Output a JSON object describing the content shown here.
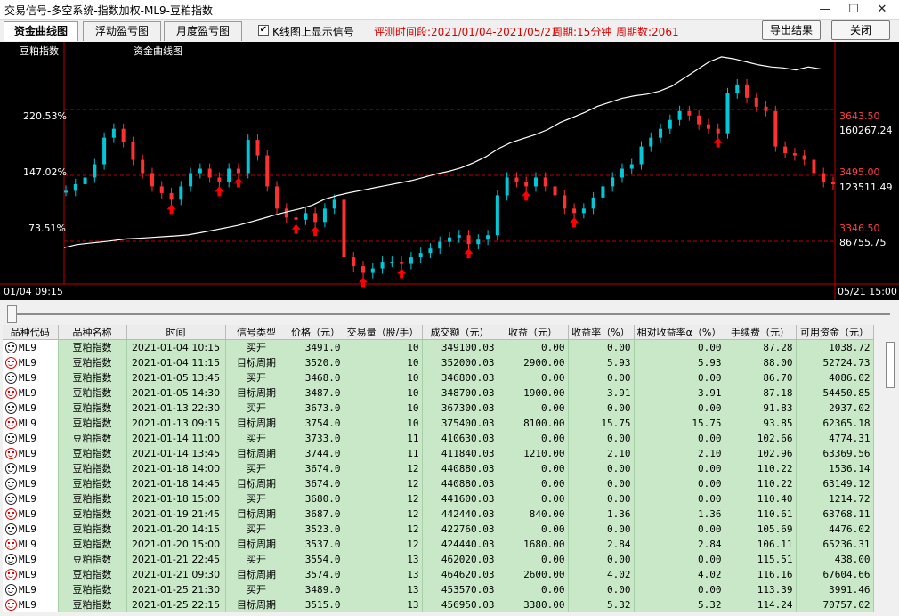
{
  "window": {
    "title": "交易信号-多空系统-指数加权-ML9-豆粕指数",
    "minimize": "—",
    "maximize": "☐",
    "close": "✕"
  },
  "toolbar": {
    "tabs": [
      {
        "label": "资金曲线图",
        "active": true
      },
      {
        "label": "浮动盈亏图",
        "active": false
      },
      {
        "label": "月度盈亏图",
        "active": false
      }
    ],
    "checkbox_checked": "✔",
    "checkbox_label": "K线图上显示信号",
    "period_range": "评测时间段:2021/01/04-2021/05/21",
    "period_type": "周期:15分钟",
    "period_count": "周期数:2061",
    "export_label": "导出结果",
    "close_label": "关闭"
  },
  "chart": {
    "label_left": "豆粕指数",
    "label_curve": "资金曲线图",
    "left_axis": [
      "220.53%",
      "147.02%",
      "73.51%"
    ],
    "price_levels": [
      "3643.50",
      "3495.00",
      "3346.50"
    ],
    "fund_levels": [
      "160267.24",
      "123511.49",
      "86755.75"
    ],
    "time_start": "01/04 09:15",
    "time_end": "05/21 15:00",
    "colors": {
      "candle_up": "#00c8d8",
      "candle_down": "#ff3030",
      "fund_line": "#ffffff",
      "grid": "#c00000",
      "signal": "#ff0000"
    }
  },
  "chart_data": {
    "type": "line",
    "series": [
      {
        "values": [
          3460,
          3475,
          3490,
          3520,
          3580,
          3600,
          3570,
          3530,
          3500,
          3470,
          3455,
          3440,
          3470,
          3500,
          3510,
          3490,
          3480,
          3510,
          3500,
          3575,
          3540,
          3470,
          3420,
          3400,
          3395,
          3410,
          3390,
          3420,
          3440,
          3310,
          3290,
          3275,
          3285,
          3300,
          3300,
          3295,
          3310,
          3320,
          3330,
          3345,
          3355,
          3360,
          3340,
          3350,
          3360,
          3450,
          3490,
          3480,
          3470,
          3490,
          3470,
          3450,
          3420,
          3410,
          3420,
          3445,
          3470,
          3490,
          3510,
          3520,
          3560,
          3580,
          3600,
          3620,
          3640,
          3630,
          3610,
          3600,
          3590,
          3680,
          3700,
          3670,
          3650,
          3640,
          3560,
          3545,
          3540,
          3530,
          3500,
          3480,
          3475
        ]
      },
      {
        "values": [
          84000,
          85500,
          86200,
          86800,
          87500,
          88300,
          88600,
          89000,
          89400,
          89800,
          90300,
          91400,
          92600,
          93800,
          95000,
          96700,
          98400,
          100200,
          101800,
          103200,
          105000,
          108000,
          109800,
          111200,
          112400,
          113600,
          114800,
          116000,
          117200,
          118800,
          120500,
          121800,
          123500,
          126000,
          129000,
          133000,
          136000,
          138000,
          140000,
          142500,
          146000,
          148500,
          151000,
          154000,
          156000,
          158000,
          159200,
          160000,
          161500,
          164000,
          168000,
          172000,
          176000,
          178500,
          177500,
          176000,
          174500,
          173500,
          173000,
          172000,
          173500,
          172500
        ]
      }
    ],
    "ylim": [
      3250,
      3760
    ],
    "y2lim": [
      66000,
      178000
    ]
  },
  "table": {
    "columns": [
      "品种代码",
      "品种名称",
      "时间",
      "信号类型",
      "价格（元）",
      "交易量（股/手）",
      "成交额（元）",
      "收益（元）",
      "收益率（%）",
      "相对收益率α（%）",
      "手续费（元）",
      "可用资金（元）"
    ],
    "rows": [
      {
        "code": "ML9",
        "name": "豆粕指数",
        "time": "2021-01-04 10:15",
        "type": "买开",
        "price": "3491.0",
        "vol": "10",
        "amount": "349100.03",
        "profit": "0.00",
        "rate": "0.00",
        "alpha": "0.00",
        "fee": "87.28",
        "cash": "1038.72",
        "face": "dark"
      },
      {
        "code": "ML9",
        "name": "豆粕指数",
        "time": "2021-01-04 11:15",
        "type": "目标周期",
        "price": "3520.0",
        "vol": "10",
        "amount": "352000.03",
        "profit": "2900.00",
        "rate": "5.93",
        "alpha": "5.93",
        "fee": "88.00",
        "cash": "52724.73",
        "face": "red"
      },
      {
        "code": "ML9",
        "name": "豆粕指数",
        "time": "2021-01-05 13:45",
        "type": "买开",
        "price": "3468.0",
        "vol": "10",
        "amount": "346800.03",
        "profit": "0.00",
        "rate": "0.00",
        "alpha": "0.00",
        "fee": "86.70",
        "cash": "4086.02",
        "face": "dark"
      },
      {
        "code": "ML9",
        "name": "豆粕指数",
        "time": "2021-01-05 14:30",
        "type": "目标周期",
        "price": "3487.0",
        "vol": "10",
        "amount": "348700.03",
        "profit": "1900.00",
        "rate": "3.91",
        "alpha": "3.91",
        "fee": "87.18",
        "cash": "54450.85",
        "face": "red"
      },
      {
        "code": "ML9",
        "name": "豆粕指数",
        "time": "2021-01-13 22:30",
        "type": "买开",
        "price": "3673.0",
        "vol": "10",
        "amount": "367300.03",
        "profit": "0.00",
        "rate": "0.00",
        "alpha": "0.00",
        "fee": "91.83",
        "cash": "2937.02",
        "face": "dark"
      },
      {
        "code": "ML9",
        "name": "豆粕指数",
        "time": "2021-01-13 09:15",
        "type": "目标周期",
        "price": "3754.0",
        "vol": "10",
        "amount": "375400.03",
        "profit": "8100.00",
        "rate": "15.75",
        "alpha": "15.75",
        "fee": "93.85",
        "cash": "62365.18",
        "face": "red"
      },
      {
        "code": "ML9",
        "name": "豆粕指数",
        "time": "2021-01-14 11:00",
        "type": "买开",
        "price": "3733.0",
        "vol": "11",
        "amount": "410630.03",
        "profit": "0.00",
        "rate": "0.00",
        "alpha": "0.00",
        "fee": "102.66",
        "cash": "4774.31",
        "face": "dark"
      },
      {
        "code": "ML9",
        "name": "豆粕指数",
        "time": "2021-01-14 13:45",
        "type": "目标周期",
        "price": "3744.0",
        "vol": "11",
        "amount": "411840.03",
        "profit": "1210.00",
        "rate": "2.10",
        "alpha": "2.10",
        "fee": "102.96",
        "cash": "63369.56",
        "face": "red"
      },
      {
        "code": "ML9",
        "name": "豆粕指数",
        "time": "2021-01-18 14:00",
        "type": "买开",
        "price": "3674.0",
        "vol": "12",
        "amount": "440880.03",
        "profit": "0.00",
        "rate": "0.00",
        "alpha": "0.00",
        "fee": "110.22",
        "cash": "1536.14",
        "face": "dark"
      },
      {
        "code": "ML9",
        "name": "豆粕指数",
        "time": "2021-01-18 14:45",
        "type": "目标周期",
        "price": "3674.0",
        "vol": "12",
        "amount": "440880.03",
        "profit": "0.00",
        "rate": "0.00",
        "alpha": "0.00",
        "fee": "110.22",
        "cash": "63149.12",
        "face": "dark"
      },
      {
        "code": "ML9",
        "name": "豆粕指数",
        "time": "2021-01-18 15:00",
        "type": "买开",
        "price": "3680.0",
        "vol": "12",
        "amount": "441600.03",
        "profit": "0.00",
        "rate": "0.00",
        "alpha": "0.00",
        "fee": "110.40",
        "cash": "1214.72",
        "face": "dark"
      },
      {
        "code": "ML9",
        "name": "豆粕指数",
        "time": "2021-01-19 21:45",
        "type": "目标周期",
        "price": "3687.0",
        "vol": "12",
        "amount": "442440.03",
        "profit": "840.00",
        "rate": "1.36",
        "alpha": "1.36",
        "fee": "110.61",
        "cash": "63768.11",
        "face": "red"
      },
      {
        "code": "ML9",
        "name": "豆粕指数",
        "time": "2021-01-20 14:15",
        "type": "买开",
        "price": "3523.0",
        "vol": "12",
        "amount": "422760.03",
        "profit": "0.00",
        "rate": "0.00",
        "alpha": "0.00",
        "fee": "105.69",
        "cash": "4476.02",
        "face": "dark"
      },
      {
        "code": "ML9",
        "name": "豆粕指数",
        "time": "2021-01-20 15:00",
        "type": "目标周期",
        "price": "3537.0",
        "vol": "12",
        "amount": "424440.03",
        "profit": "1680.00",
        "rate": "2.84",
        "alpha": "2.84",
        "fee": "106.11",
        "cash": "65236.31",
        "face": "red"
      },
      {
        "code": "ML9",
        "name": "豆粕指数",
        "time": "2021-01-21 22:45",
        "type": "买开",
        "price": "3554.0",
        "vol": "13",
        "amount": "462020.03",
        "profit": "0.00",
        "rate": "0.00",
        "alpha": "0.00",
        "fee": "115.51",
        "cash": "438.00",
        "face": "dark"
      },
      {
        "code": "ML9",
        "name": "豆粕指数",
        "time": "2021-01-21 09:30",
        "type": "目标周期",
        "price": "3574.0",
        "vol": "13",
        "amount": "464620.03",
        "profit": "2600.00",
        "rate": "4.02",
        "alpha": "4.02",
        "fee": "116.16",
        "cash": "67604.66",
        "face": "red"
      },
      {
        "code": "ML9",
        "name": "豆粕指数",
        "time": "2021-01-25 21:30",
        "type": "买开",
        "price": "3489.0",
        "vol": "13",
        "amount": "453570.03",
        "profit": "0.00",
        "rate": "0.00",
        "alpha": "0.00",
        "fee": "113.39",
        "cash": "3991.46",
        "face": "dark"
      },
      {
        "code": "ML9",
        "name": "豆粕指数",
        "time": "2021-01-25 22:15",
        "type": "目标周期",
        "price": "3515.0",
        "vol": "13",
        "amount": "456950.03",
        "profit": "3380.00",
        "rate": "5.32",
        "alpha": "5.32",
        "fee": "114.24",
        "cash": "70757.02",
        "face": "red"
      }
    ]
  }
}
